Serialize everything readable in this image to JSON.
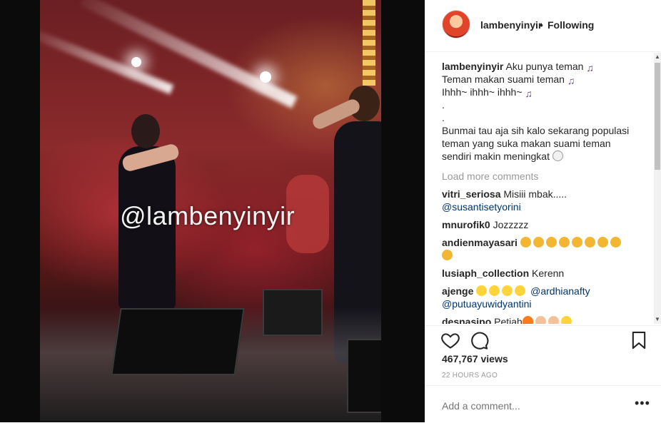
{
  "media": {
    "watermark": "@lambenyinyir"
  },
  "header": {
    "username": "lambenyinyir",
    "separator": "•",
    "follow_status": "Following"
  },
  "caption": {
    "username": "lambenyinyir",
    "lines": [
      "Aku punya teman",
      "Teman makan suami teman",
      "Ihhh~ ihhh~ ihhh~",
      ".",
      ".",
      "Bunmai tau aja sih kalo sekarang populasi",
      "teman yang suka makan suami teman",
      "sendiri makin meningkat"
    ]
  },
  "load_more": "Load more comments",
  "comments": [
    {
      "user": "vitri_seriosa",
      "text": "Misiii mbak.....",
      "mention": "@susantisetyorini"
    },
    {
      "user": "mnurofik0",
      "text": "Jozzzzz"
    },
    {
      "user": "andienmayasari",
      "text": ""
    },
    {
      "user": "lusiaph_collection",
      "text": "Kerenn"
    },
    {
      "user": "ajenge",
      "mention": "@ardhianafty",
      "mention2": "@putuayuwidyantini"
    },
    {
      "user": "desnasipo",
      "text": "Petjah"
    }
  ],
  "icons": {
    "like": "heart-icon",
    "comment": "comment-icon",
    "save": "bookmark-icon",
    "options": "more-options-icon"
  },
  "stats": {
    "views": "467,767 views",
    "time": "22 HOURS AGO"
  },
  "add_comment": {
    "placeholder": "Add a comment...",
    "more": "•••"
  },
  "colors": {
    "text": "#262626",
    "muted": "#999999",
    "link": "#003569"
  }
}
